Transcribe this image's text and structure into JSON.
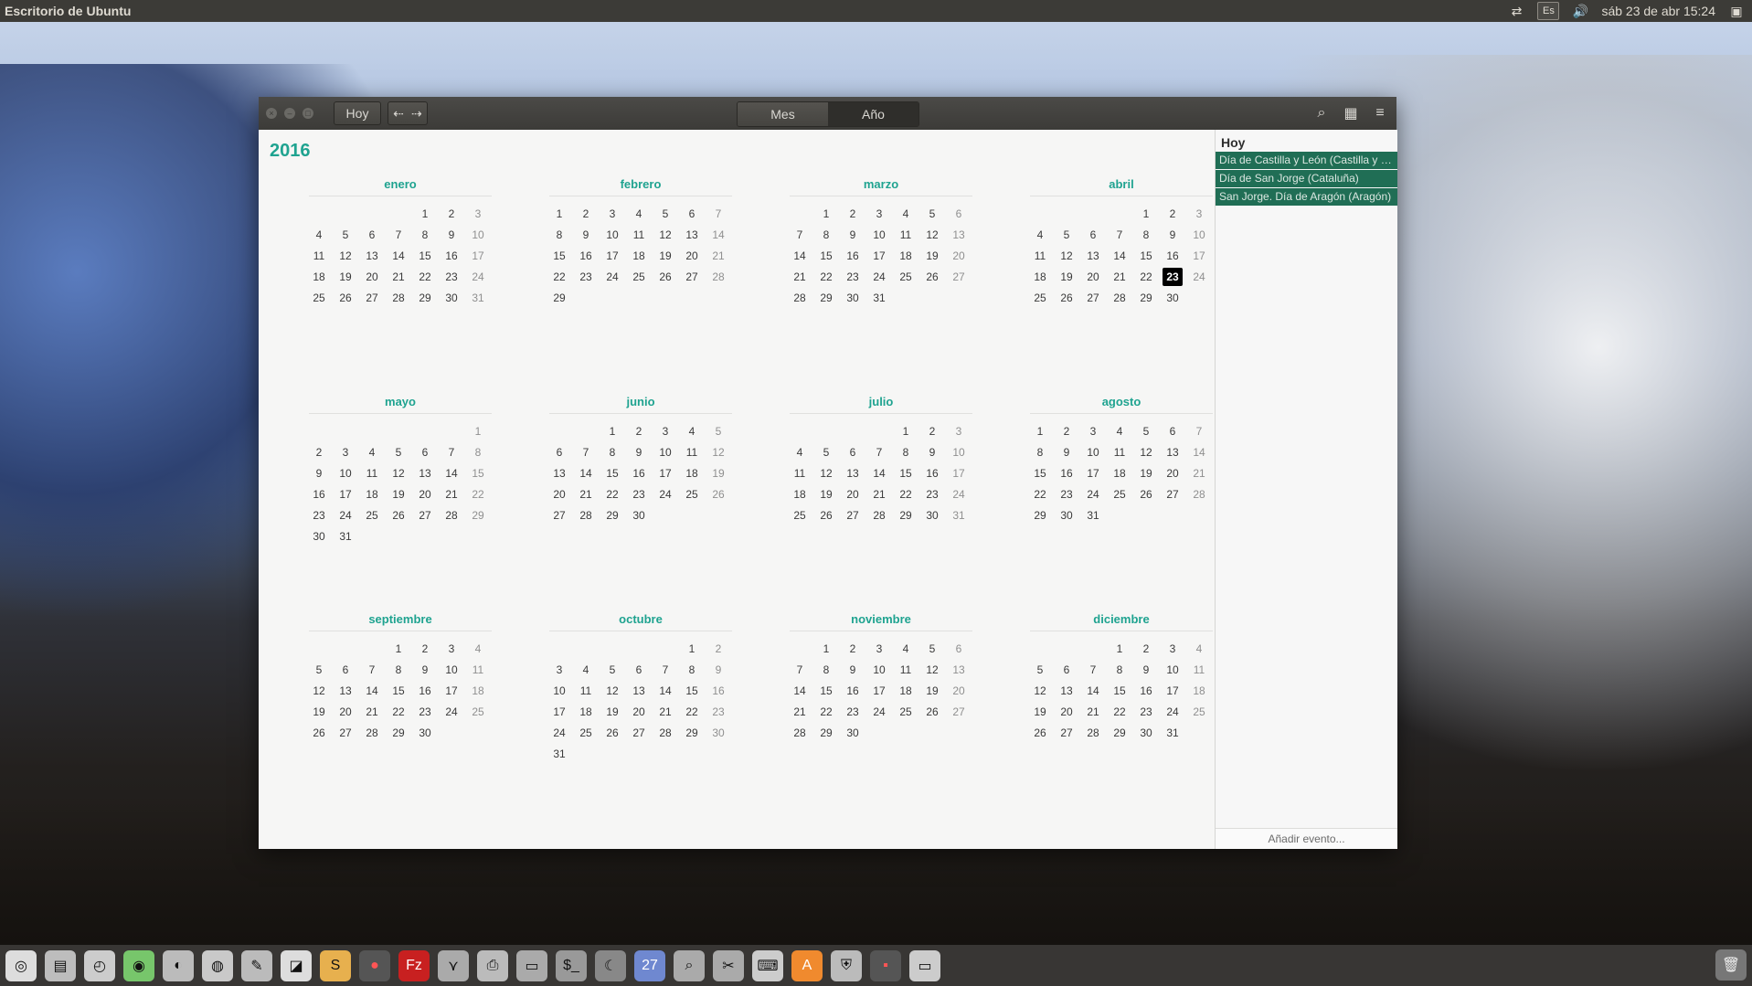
{
  "top_panel": {
    "app_title": "Escritorio de Ubuntu",
    "keyboard": "Es",
    "datetime": "sáb 23 de abr 15:24"
  },
  "toolbar": {
    "today": "Hoy",
    "views": [
      "Mes",
      "Año"
    ],
    "active_view": "Año"
  },
  "year_view": {
    "year": "2016",
    "months": [
      {
        "name": "enero",
        "days": [
          "1",
          "2",
          "3",
          "4",
          "5",
          "6",
          "7",
          "8",
          "9",
          "10",
          "11",
          "12",
          "13",
          "14",
          "15",
          "16",
          "17",
          "18",
          "19",
          "20",
          "21",
          "22",
          "23",
          "24",
          "25",
          "26",
          "27",
          "28",
          "29",
          "30",
          "31"
        ]
      },
      {
        "name": "febrero",
        "days": [
          "1",
          "2",
          "3",
          "4",
          "5",
          "6",
          "7",
          "8",
          "9",
          "10",
          "11",
          "12",
          "13",
          "14",
          "15",
          "16",
          "17",
          "18",
          "19",
          "20",
          "21",
          "22",
          "23",
          "24",
          "25",
          "26",
          "27",
          "28",
          "29"
        ]
      },
      {
        "name": "marzo",
        "days": [
          "1",
          "2",
          "3",
          "4",
          "5",
          "6",
          "7",
          "8",
          "9",
          "10",
          "11",
          "12",
          "13",
          "14",
          "15",
          "16",
          "17",
          "18",
          "19",
          "20",
          "21",
          "22",
          "23",
          "24",
          "25",
          "26",
          "27",
          "28",
          "29",
          "30",
          "31"
        ]
      },
      {
        "name": "abril",
        "days": [
          "1",
          "2",
          "3",
          "4",
          "5",
          "6",
          "7",
          "8",
          "9",
          "10",
          "11",
          "12",
          "13",
          "14",
          "15",
          "16",
          "17",
          "18",
          "19",
          "20",
          "21",
          "22",
          "23",
          "24",
          "25",
          "26",
          "27",
          "28",
          "29",
          "30"
        ]
      },
      {
        "name": "mayo",
        "days": [
          "1",
          "2",
          "3",
          "4",
          "5",
          "6",
          "7",
          "8",
          "9",
          "10",
          "11",
          "12",
          "13",
          "14",
          "15",
          "16",
          "17",
          "18",
          "19",
          "20",
          "21",
          "22",
          "23",
          "24",
          "25",
          "26",
          "27",
          "28",
          "29",
          "30",
          "31"
        ]
      },
      {
        "name": "junio",
        "days": [
          "1",
          "2",
          "3",
          "4",
          "5",
          "6",
          "7",
          "8",
          "9",
          "10",
          "11",
          "12",
          "13",
          "14",
          "15",
          "16",
          "17",
          "18",
          "19",
          "20",
          "21",
          "22",
          "23",
          "24",
          "25",
          "26",
          "27",
          "28",
          "29",
          "30"
        ]
      },
      {
        "name": "julio",
        "days": [
          "1",
          "2",
          "3",
          "4",
          "5",
          "6",
          "7",
          "8",
          "9",
          "10",
          "11",
          "12",
          "13",
          "14",
          "15",
          "16",
          "17",
          "18",
          "19",
          "20",
          "21",
          "22",
          "23",
          "24",
          "25",
          "26",
          "27",
          "28",
          "29",
          "30",
          "31"
        ]
      },
      {
        "name": "agosto",
        "days": [
          "1",
          "2",
          "3",
          "4",
          "5",
          "6",
          "7",
          "8",
          "9",
          "10",
          "11",
          "12",
          "13",
          "14",
          "15",
          "16",
          "17",
          "18",
          "19",
          "20",
          "21",
          "22",
          "23",
          "24",
          "25",
          "26",
          "27",
          "28",
          "29",
          "30",
          "31"
        ]
      },
      {
        "name": "septiembre",
        "days": [
          "1",
          "2",
          "3",
          "4",
          "5",
          "6",
          "7",
          "8",
          "9",
          "10",
          "11",
          "12",
          "13",
          "14",
          "15",
          "16",
          "17",
          "18",
          "19",
          "20",
          "21",
          "22",
          "23",
          "24",
          "25",
          "26",
          "27",
          "28",
          "29",
          "30"
        ]
      },
      {
        "name": "octubre",
        "days": [
          "1",
          "2",
          "3",
          "4",
          "5",
          "6",
          "7",
          "8",
          "9",
          "10",
          "11",
          "12",
          "13",
          "14",
          "15",
          "16",
          "17",
          "18",
          "19",
          "20",
          "21",
          "22",
          "23",
          "24",
          "25",
          "26",
          "27",
          "28",
          "29",
          "30",
          "31"
        ]
      },
      {
        "name": "noviembre",
        "days": [
          "1",
          "2",
          "3",
          "4",
          "5",
          "6",
          "7",
          "8",
          "9",
          "10",
          "11",
          "12",
          "13",
          "14",
          "15",
          "16",
          "17",
          "18",
          "19",
          "20",
          "21",
          "22",
          "23",
          "24",
          "25",
          "26",
          "27",
          "28",
          "29",
          "30"
        ]
      },
      {
        "name": "diciembre",
        "days": [
          "1",
          "2",
          "3",
          "4",
          "5",
          "6",
          "7",
          "8",
          "9",
          "10",
          "11",
          "12",
          "13",
          "14",
          "15",
          "16",
          "17",
          "18",
          "19",
          "20",
          "21",
          "22",
          "23",
          "24",
          "25",
          "26",
          "27",
          "28",
          "29",
          "30",
          "31"
        ]
      }
    ],
    "today_day": "23",
    "today_month": "abril"
  },
  "sidebar": {
    "title": "Hoy",
    "events": [
      "Día de Castilla y León (Castilla y L...",
      "Día de San Jorge (Cataluña)",
      "San Jorge. Día de Aragón (Aragón)"
    ],
    "add_event": "Añadir evento..."
  },
  "colors": {
    "accent": "#1fa390",
    "event": "#206e55",
    "panel": "#3c3b37"
  },
  "dock_icons": [
    "ubuntu-icon",
    "files-icon",
    "clock-icon",
    "globe-icon",
    "firefox-icon",
    "chrome-icon",
    "editor-icon",
    "document-icon",
    "sublime-icon",
    "media-icon",
    "filezilla-icon",
    "fish-icon",
    "printer-icon",
    "monitor-icon",
    "terminal-icon",
    "moon-icon",
    "calendar-icon",
    "search-icon",
    "brush-icon",
    "keyboard-icon",
    "store-icon",
    "shield-icon",
    "window-icon",
    "disk-icon"
  ]
}
